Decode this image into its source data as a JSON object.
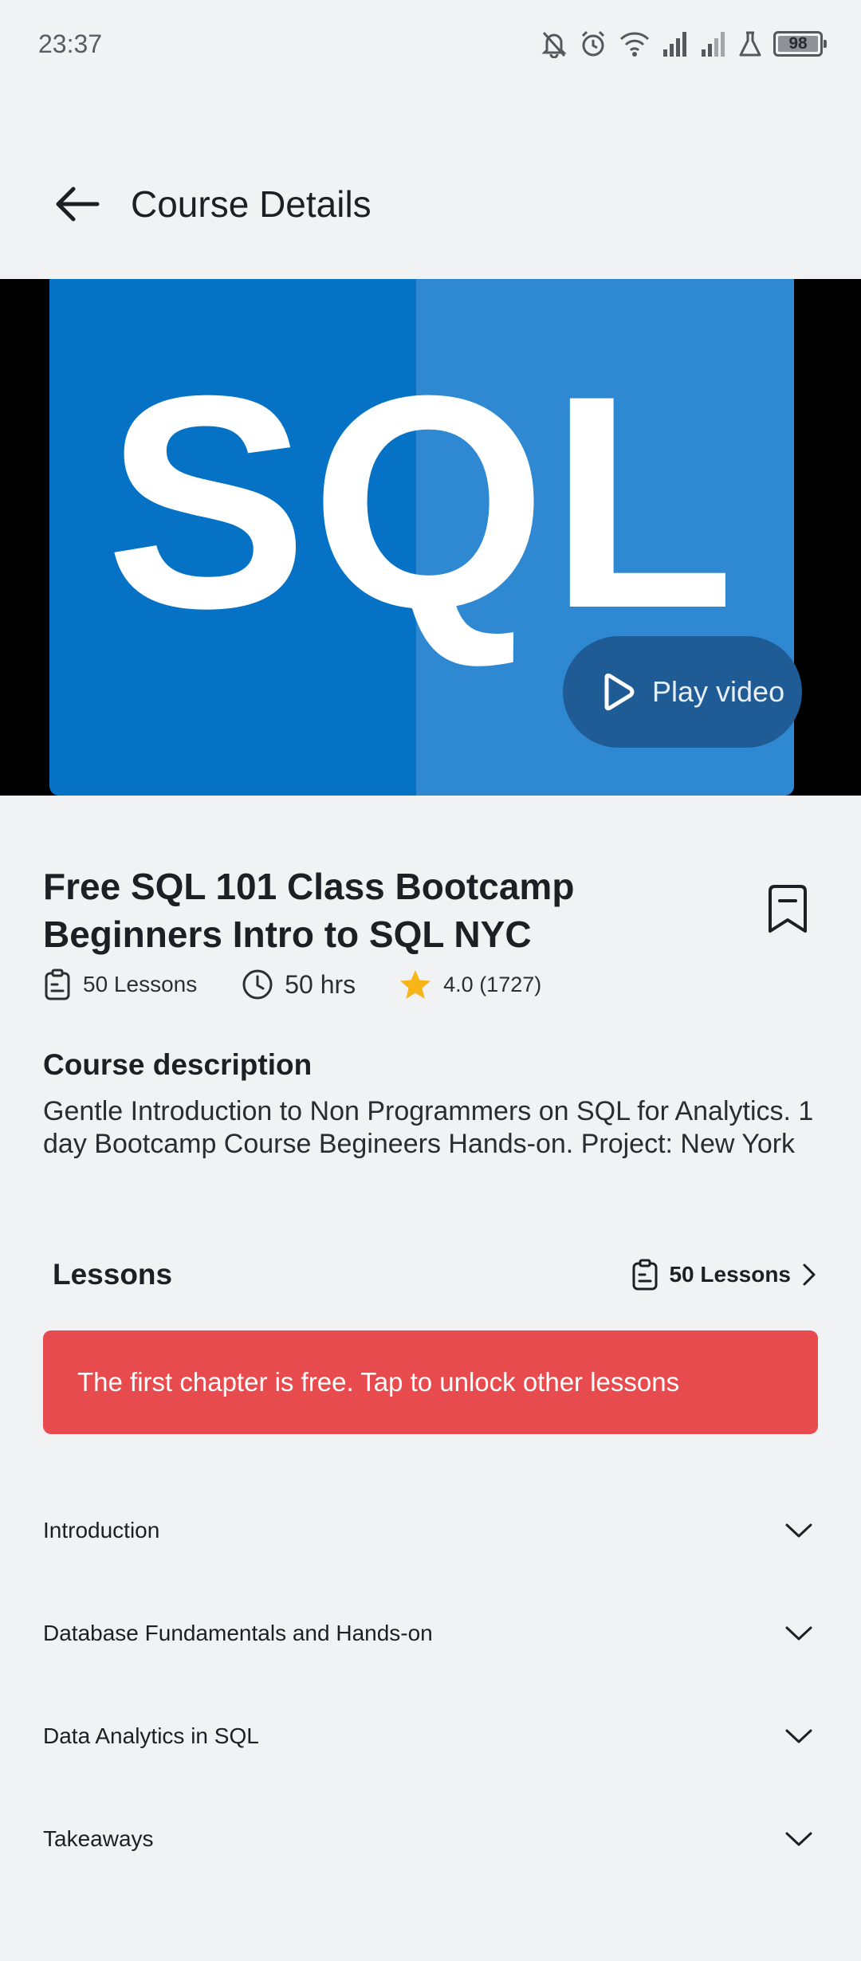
{
  "status_bar": {
    "time": "23:37",
    "battery": "98",
    "icons": [
      "bell-off-icon",
      "alarm-icon",
      "wifi-icon",
      "signal-icon",
      "signal-icon-2",
      "lab-icon",
      "battery-icon"
    ]
  },
  "header": {
    "title": "Course Details",
    "back_icon": "arrow-left-icon"
  },
  "video": {
    "logo_text": "SQL",
    "play_label": "Play video",
    "colors": {
      "left": "#0672c5",
      "right": "#2e88d2",
      "play_bg": "#1f5c95"
    }
  },
  "course": {
    "title": "Free SQL 101 Class Bootcamp Beginners Intro to SQL NYC",
    "lessons": "50 Lessons",
    "hours": "50 hrs",
    "rating": "4.0 (1727)"
  },
  "description": {
    "heading": "Course description",
    "text": "Gentle Introduction to Non Programmers on SQL for Analytics. 1 day Bootcamp Course Begineers Hands-on. Project: New York"
  },
  "lessons_section": {
    "heading": "Lessons",
    "link_label": "50 Lessons",
    "banner": "The first chapter is free. Tap to unlock other lessons",
    "banner_color": "#e84b4e",
    "chapters": [
      {
        "label": "Introduction"
      },
      {
        "label": "Database Fundamentals and Hands-on"
      },
      {
        "label": "Data Analytics in SQL"
      },
      {
        "label": "Takeaways"
      }
    ]
  }
}
